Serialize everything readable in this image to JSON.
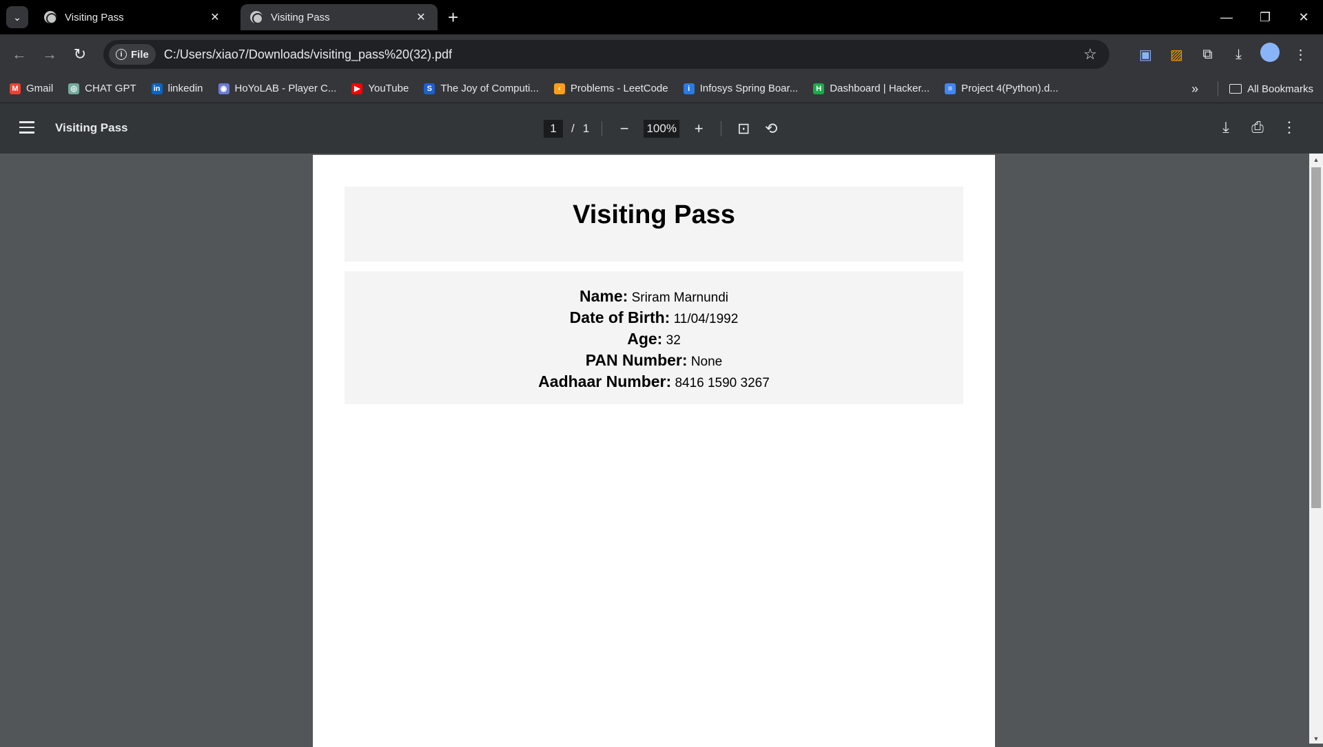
{
  "tabs": [
    {
      "title": "Visiting Pass",
      "active": false
    },
    {
      "title": "Visiting Pass",
      "active": true
    }
  ],
  "omnibox": {
    "scheme_chip": "File",
    "url": "C:/Users/xiao7/Downloads/visiting_pass%20(32).pdf"
  },
  "bookmarks": [
    {
      "label": "Gmail",
      "icon": "gmail-icon",
      "color": "#ea4335",
      "glyph": "M"
    },
    {
      "label": "CHAT GPT",
      "icon": "chatgpt-icon",
      "color": "#74aa9c",
      "glyph": "◎"
    },
    {
      "label": "linkedin",
      "icon": "linkedin-icon",
      "color": "#0a66c2",
      "glyph": "in"
    },
    {
      "label": "HoYoLAB - Player C...",
      "icon": "hoyolab-icon",
      "color": "#6b7bd6",
      "glyph": "◉"
    },
    {
      "label": "YouTube",
      "icon": "youtube-icon",
      "color": "#ff0000",
      "glyph": "▶"
    },
    {
      "label": "The Joy of Computi...",
      "icon": "swayam-icon",
      "color": "#1e5fd6",
      "glyph": "S"
    },
    {
      "label": "Problems - LeetCode",
      "icon": "leetcode-icon",
      "color": "#f89f1b",
      "glyph": "‹"
    },
    {
      "label": "Infosys Spring Boar...",
      "icon": "infosys-icon",
      "color": "#2a7ae2",
      "glyph": "i"
    },
    {
      "label": "Dashboard | Hacker...",
      "icon": "hackerrank-icon",
      "color": "#1ba94c",
      "glyph": "H"
    },
    {
      "label": "Project 4(Python).d...",
      "icon": "google-docs-icon",
      "color": "#4285f4",
      "glyph": "≡"
    }
  ],
  "all_bookmarks_label": "All Bookmarks",
  "pdf": {
    "doc_title": "Visiting Pass",
    "current_page": "1",
    "total_pages": "1",
    "zoom": "100%"
  },
  "document": {
    "heading": "Visiting Pass",
    "fields": [
      {
        "label": "Name:",
        "value": "Sriram Marnundi"
      },
      {
        "label": "Date of Birth:",
        "value": "11/04/1992"
      },
      {
        "label": "Age:",
        "value": "32"
      },
      {
        "label": "PAN Number:",
        "value": "None"
      },
      {
        "label": "Aadhaar Number:",
        "value": "8416 1590 3267"
      }
    ]
  }
}
